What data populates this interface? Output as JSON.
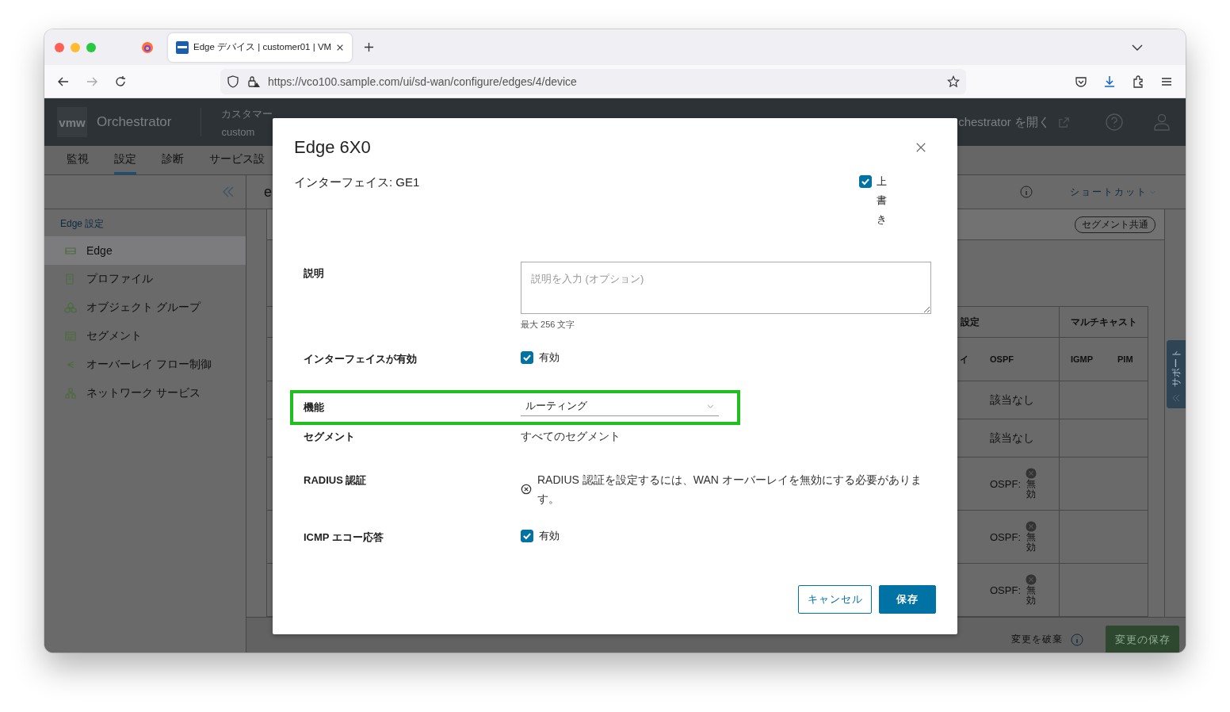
{
  "browser": {
    "tab": {
      "title": "Edge デバイス | customer01 | VM",
      "selected": true
    },
    "url": "https://vco100.sample.com/ui/sd-wan/configure/edges/4/device"
  },
  "app": {
    "logo": "vmw",
    "product": "Orchestrator",
    "customer_label": "カスタマー",
    "customer_value": "custom",
    "open_link": "chestrator を開く",
    "nav_tabs": [
      {
        "label": "監視",
        "selected": false
      },
      {
        "label": "設定",
        "selected": true
      },
      {
        "label": "診断",
        "selected": false
      },
      {
        "label": "サービス設",
        "selected": false
      }
    ],
    "sidebar": {
      "heading": "Edge 設定",
      "items": [
        {
          "label": "Edge",
          "selected": true
        },
        {
          "label": "プロファイル",
          "selected": false
        },
        {
          "label": "オブジェクト グループ",
          "selected": false
        },
        {
          "label": "セグメント",
          "selected": false
        },
        {
          "label": "オーバーレイ フロー制御",
          "selected": false
        },
        {
          "label": "ネットワーク サービス",
          "selected": false
        }
      ]
    },
    "content_title": "e",
    "shortcuts": "ショートカット",
    "segment_badge": "セグメント共通",
    "table": {
      "group_headers": [
        "設定",
        "マルチキャスト"
      ],
      "columns": [
        "イ",
        "OSPF",
        "IGMP",
        "PIM"
      ],
      "rows": [
        {
          "ospf": "該当なし"
        },
        {
          "ospf": "該当なし"
        },
        {
          "ospf": "OSPF:",
          "status": "無効"
        },
        {
          "ospf": "OSPF:",
          "status": "無効"
        },
        {
          "ospf": "OSPF:",
          "status": "無効"
        }
      ]
    },
    "support_tab": "サポート",
    "discard": "変更を破棄",
    "save_changes": "変更の保存"
  },
  "dialog": {
    "title": "Edge 6X0",
    "subtitle": "インターフェイス: GE1",
    "override": {
      "label": "上書き",
      "checked": true
    },
    "fields": [
      {
        "label": "説明",
        "kind": "textarea",
        "placeholder": "説明を入力 (オプション)",
        "hint": "最大 256 文字",
        "highlighted": false
      },
      {
        "label": "インターフェイスが有効",
        "kind": "checkbox",
        "checked": true,
        "text": "有効",
        "highlighted": false
      },
      {
        "label": "機能",
        "kind": "select",
        "value": "ルーティング",
        "highlighted": true
      },
      {
        "label": "セグメント",
        "kind": "text",
        "value": "すべてのセグメント",
        "highlighted": false
      },
      {
        "label": "RADIUS 認証",
        "kind": "error",
        "value": "RADIUS 認証を設定するには、WAN オーバーレイを無効にする必要があります。",
        "highlighted": false
      },
      {
        "label": "ICMP エコー応答",
        "kind": "checkbox",
        "checked": true,
        "text": "有効",
        "highlighted": false
      }
    ],
    "buttons": [
      {
        "label": "キャンセル",
        "kind": "secondary"
      },
      {
        "label": "保存",
        "kind": "primary"
      }
    ]
  }
}
